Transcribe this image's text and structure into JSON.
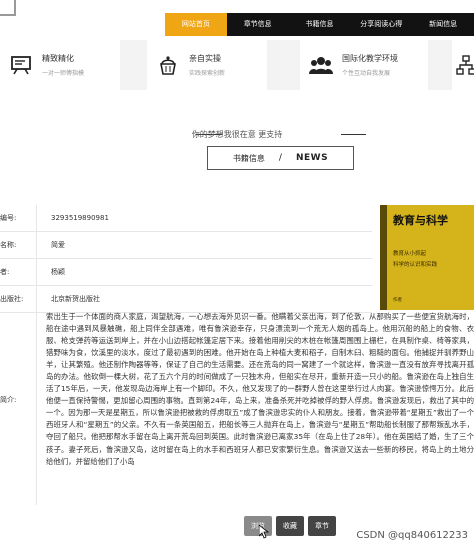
{
  "nav": {
    "items": [
      {
        "label": "网站首页",
        "active": true
      },
      {
        "label": "章节信息"
      },
      {
        "label": "书籍信息"
      },
      {
        "label": "分享阅读心得"
      },
      {
        "label": "新闻信息"
      }
    ]
  },
  "features": [
    {
      "title": "精致精化",
      "subtitle": "一对一师傅指模",
      "icon": "board-icon"
    },
    {
      "title": "亲自实操",
      "subtitle": "实践探索创新",
      "icon": "cake-icon"
    },
    {
      "title": "国际化教学环境",
      "subtitle": "个性互动自我发展",
      "icon": "group-icon"
    },
    {
      "title": "",
      "subtitle": "",
      "icon": "network-icon"
    }
  ],
  "section": {
    "subtitle": "你的梦想我很在意 更支持",
    "tab_cn": "书籍信息",
    "tab_sep": "/",
    "tab_en": "NEWS"
  },
  "book": {
    "rows": [
      {
        "label": "编号:",
        "value": "3293519890981"
      },
      {
        "label": "名称:",
        "value": "简爱"
      },
      {
        "label": "者:",
        "value": "杨颖"
      },
      {
        "label": "出版社:",
        "value": "北京新贺出版社"
      }
    ],
    "intro_label": "简介:",
    "intro": "索出生于一个体面的商人家庭，渴望航海，一心想去海外见识一番。他瞒着父亲出海，到了伦敦，从那购买了一些便宜货航海时，船在途中遇到风暴触礁，船上同伴全部遇难，唯有鲁滨逊幸存，只身漂流到一个荒无人烟的孤岛上。他用沉船的船上的食物、衣服、枪支弹药等运送到岸上，并在小山边搭起帐篷定居下来。接着他用削尖的木桩在帐篷周围围上栅栏，在具制作桌、椅等家具，猎野味为食，饮溪里的淡水，度过了最初遇到的困难。他开始在岛上种植大麦和稻子，自制木臼、粗糙的面包。他捕捉并驯养野山羊，让其繁殖。他还制作陶器等等，保证了自己的生活需要。还在荒岛的同一窝建了一个就这样，鲁滨逊一直没有放弃寻找离开孤岛的办法。他砍倒一棵大树，花了五六个月的时间做成了一只独木舟，但船实在尽开，重新开造一只小的船。鲁滨逊在岛上独自生活了15年后，一天，他发现岛边海岸上有一个脚印。不久，他又发现了的一群野人曾在这里举行过人肉宴。鲁滨逊惊愕万分。此后他便一直保持警惕，更加留心周围的事物。直到第24年，岛上来，准备杀死并吃掉被俘的野人俘虏。鲁滨逊发现后，救出了其中的一个。因为那一天是星期五，所以鲁滨逊把被救的俘虏取五”成了鲁滨逊忠实的仆人和朋友。接着，鲁滨逊带着“星期五”救出了一个西班牙人和“星期五”的父亲。不久有一条英国船五，把船长等三人抛弃在岛上，鲁滨逊与“星期五”帮助船长制服了那帮叛乱水手，夺回了船只。他把那帮水手留在岛上离开荒岛回到英国。此时鲁滨逊已离家35年（在岛上住了28年）。他在英国结了婚，生了三个孩子。妻子死后，鲁滨逊又岛，这时留在岛上的水手和西班牙人都已安家繁衍生息。鲁滨逊又送去一些新的移民，将岛上的土地分给他们，并留给他们了小岛"
  },
  "cover": {
    "title": "教育与科学",
    "lines": [
      "教育从小抓起",
      "科学的认识和实践"
    ],
    "foot": "作者"
  },
  "buttons": [
    {
      "label": "浏览"
    },
    {
      "label": "收藏"
    },
    {
      "label": "章节"
    }
  ],
  "watermark": "CSDN @qq840612233",
  "colors": {
    "accent": "#f0a514",
    "nav_bg": "#121212"
  }
}
